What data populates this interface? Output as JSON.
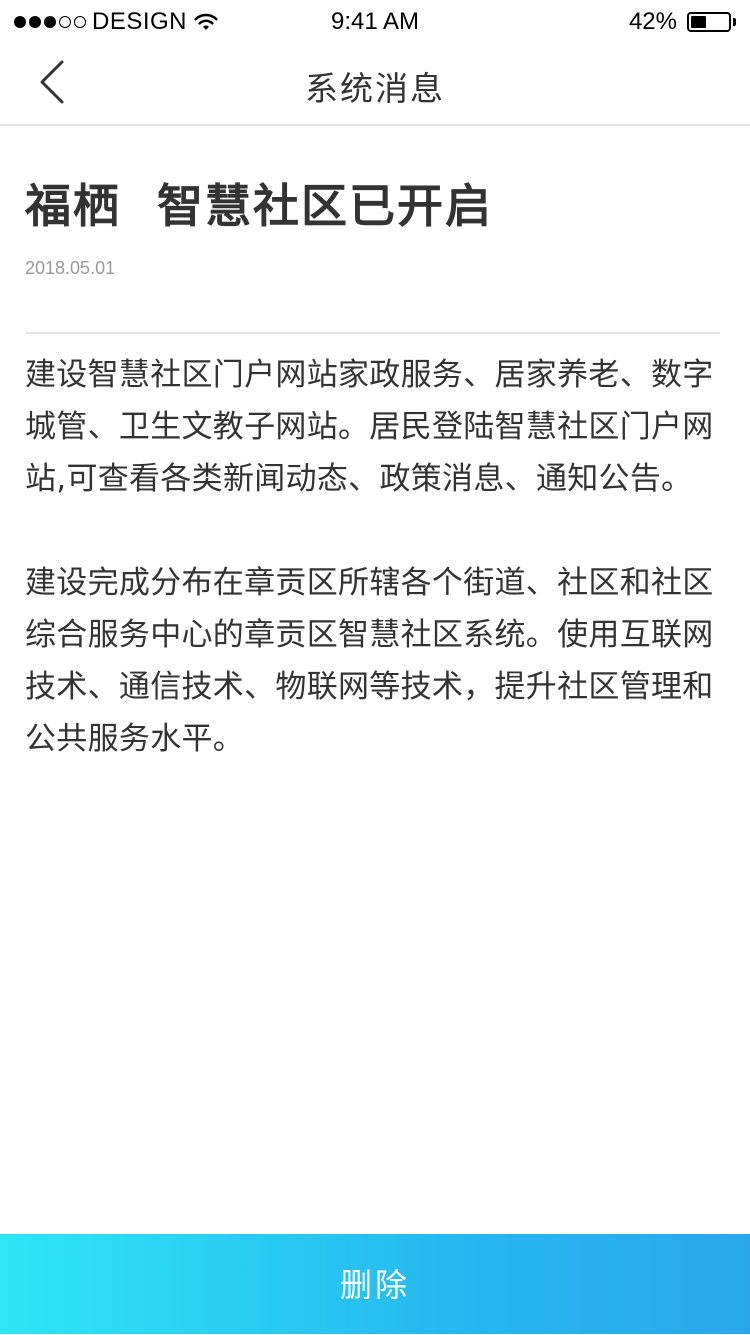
{
  "status_bar": {
    "carrier": "DESIGN",
    "signal_bars_filled": 3,
    "signal_bars_total": 5,
    "time": "9:41 AM",
    "battery_percent": "42%",
    "battery_level": 0.42
  },
  "nav": {
    "back_icon": "chevron-left-icon",
    "title": "系统消息"
  },
  "article": {
    "title": "福栖  智慧社区已开启",
    "date": "2018.05.01",
    "paragraphs": [
      "建设智慧社区门户网站家政服务、居家养老、数字城管、卫生文教子网站。居民登陆智慧社区门户网站,可查看各类新闻动态、政策消息、通知公告。",
      "建设完成分布在章贡区所辖各个街道、社区和社区综合服务中心的章贡区智慧社区系统。使用互联网技术、通信技术、物联网等技术，提升社区管理和公共服务水平。"
    ]
  },
  "footer": {
    "delete_label": "删除"
  },
  "colors": {
    "button_gradient_start": "#2ee6f6",
    "button_gradient_end": "#2aa7ec",
    "title_text": "#333333",
    "date_text": "#999999"
  }
}
